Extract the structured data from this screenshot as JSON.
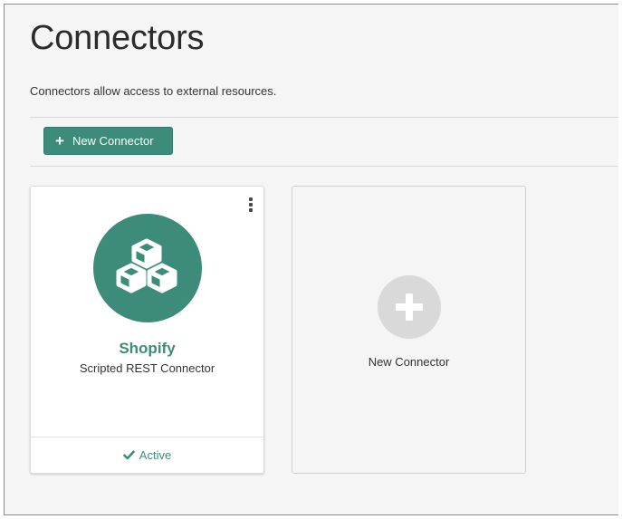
{
  "page": {
    "title": "Connectors",
    "description": "Connectors allow access to external resources."
  },
  "toolbar": {
    "new_button_icon": "plus-icon",
    "new_button_label": "New Connector"
  },
  "connectors": [
    {
      "name": "Shopify",
      "type": "Scripted REST Connector",
      "icon": "cubes-icon",
      "status": "Active",
      "status_icon": "check-icon"
    }
  ],
  "add_card": {
    "icon": "plus-circle-icon",
    "label": "New Connector"
  },
  "colors": {
    "accent": "#3d8b79",
    "background": "#f5f5f5",
    "add_circle": "#d9d9d9"
  }
}
